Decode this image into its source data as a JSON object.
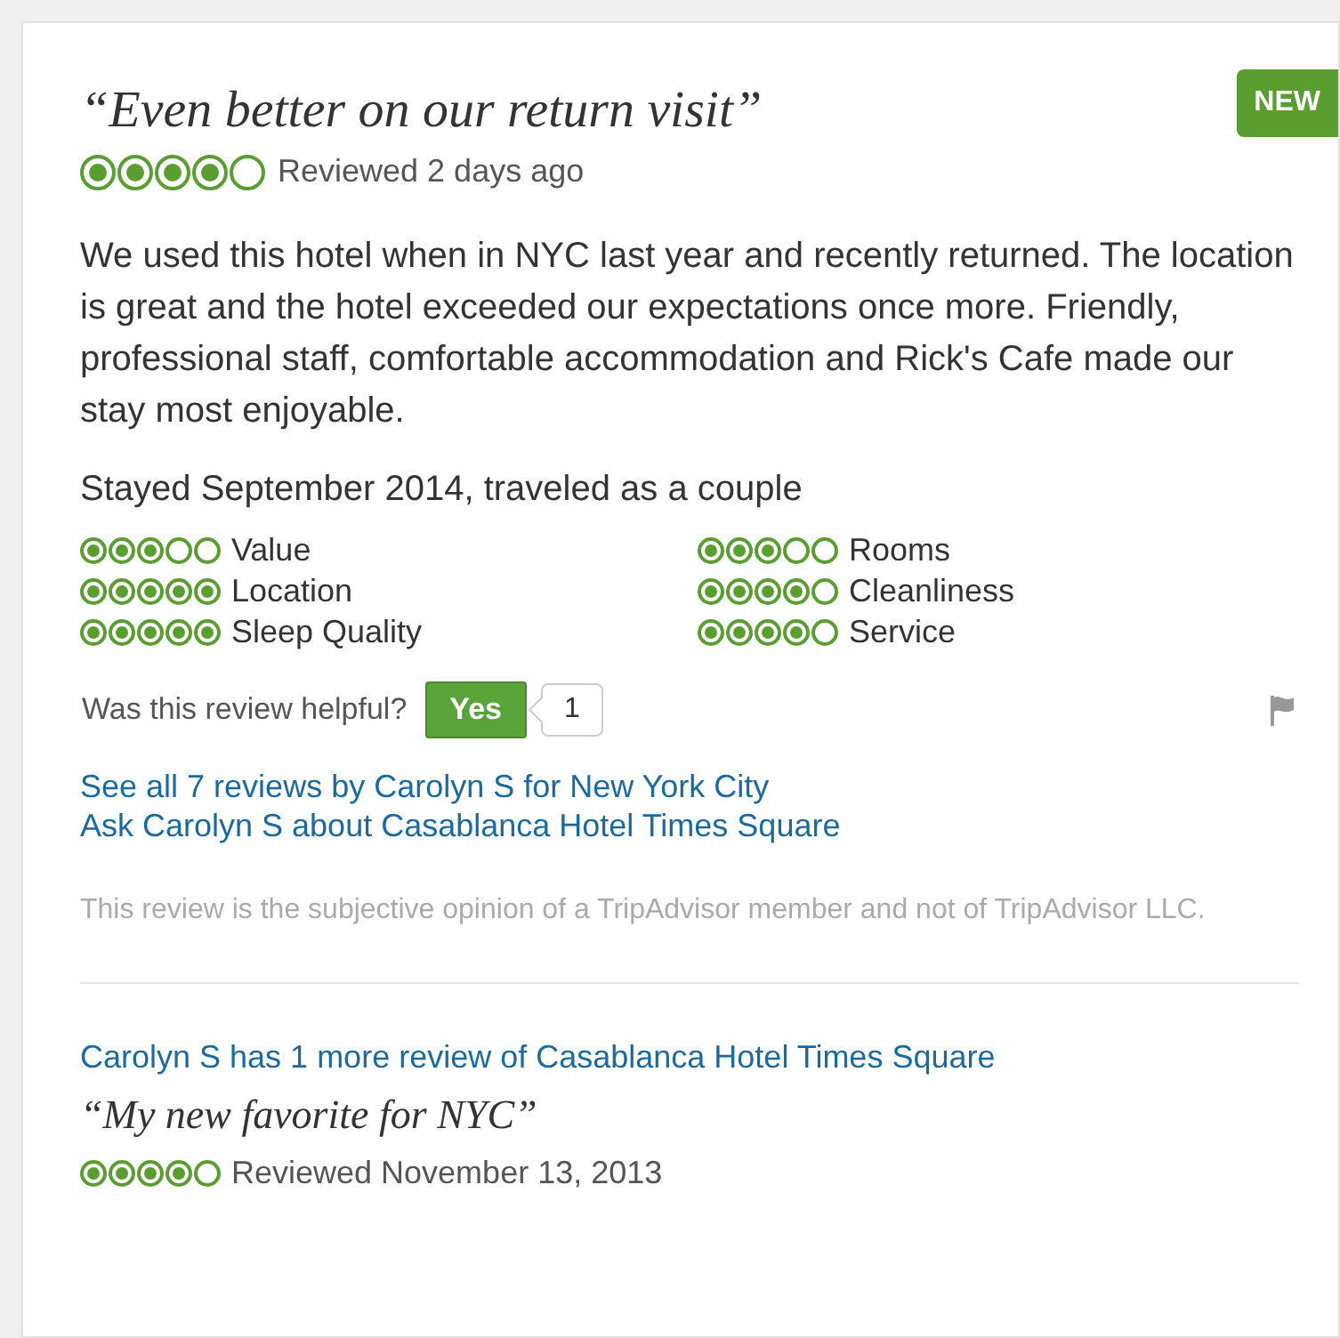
{
  "review": {
    "title": "“Even better on our return visit”",
    "stars": 4,
    "reviewed": "Reviewed 2 days ago",
    "badge": "NEW",
    "body": "We used this hotel when in NYC last year and recently returned. The location is great and the hotel exceeded our expectations once more. Friendly, professional staff, comfortable accommodation and Rick's Cafe made our stay most enjoyable.",
    "stayed": "Stayed September 2014, traveled as a couple",
    "ratings": [
      {
        "label": "Value",
        "stars": 3
      },
      {
        "label": "Rooms",
        "stars": 3
      },
      {
        "label": "Location",
        "stars": 5
      },
      {
        "label": "Cleanliness",
        "stars": 4
      },
      {
        "label": "Sleep Quality",
        "stars": 5
      },
      {
        "label": "Service",
        "stars": 4
      }
    ],
    "helpful": {
      "question": "Was this review helpful?",
      "button": "Yes",
      "count": "1"
    },
    "links": [
      "See all 7 reviews by Carolyn S for New York City",
      "Ask Carolyn S about Casablanca Hotel Times Square"
    ],
    "disclaimer": "This review is the subjective opinion of a TripAdvisor member and not of TripAdvisor LLC."
  },
  "more": {
    "heading": "Carolyn S has 1 more review of Casablanca Hotel Times Square",
    "title": "“My new favorite for NYC”",
    "stars": 4,
    "reviewed": "Reviewed November 13, 2013"
  }
}
